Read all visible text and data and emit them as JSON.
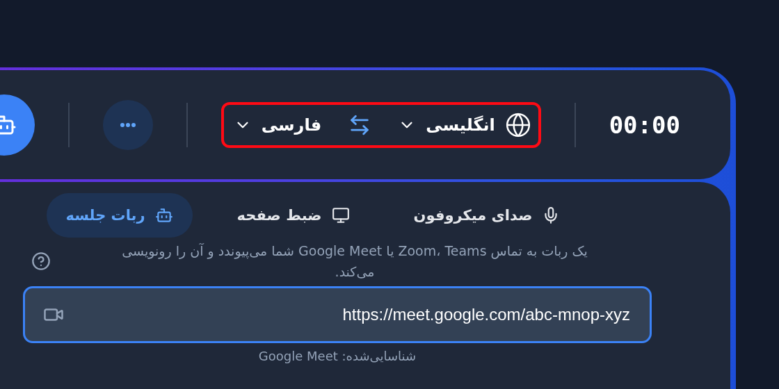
{
  "toolbar": {
    "timer": "00:00",
    "language_pair": {
      "highlighted": true,
      "source": "انگلیسی",
      "target": "فارسی"
    }
  },
  "mode_tabs": [
    {
      "label": "صدای میکروفون",
      "kind": "mic",
      "selected": false
    },
    {
      "label": "ضبط صفحه",
      "kind": "screen",
      "selected": false
    },
    {
      "label": "ربات جلسه",
      "kind": "bot",
      "selected": true
    }
  ],
  "description": "یک ربات به تماس Zoom، Teams یا Google Meet شما می‌پیوندد و آن را رونویسی می‌کند.",
  "meeting_link": {
    "value": "https://meet.google.com/abc-mnop-xyz"
  },
  "detected": "شناسایی‌شده: Google Meet"
}
